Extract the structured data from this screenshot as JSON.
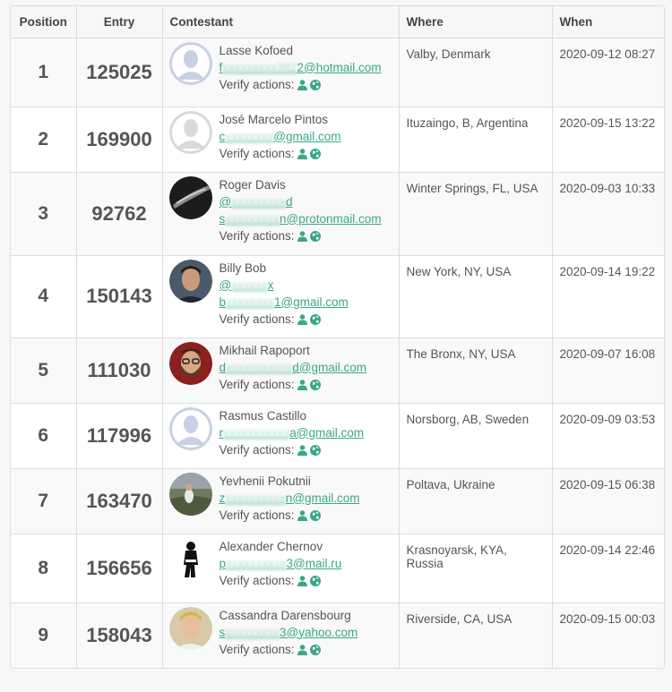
{
  "headers": {
    "position": "Position",
    "entry": "Entry",
    "contestant": "Contestant",
    "where": "Where",
    "when": "When"
  },
  "verify_label": "Verify actions:",
  "colors": {
    "accent": "#3aa68a",
    "header_bg": "#f7f7f7",
    "border": "#dddddd"
  },
  "rows": [
    {
      "position": "1",
      "entry": "125025",
      "name": "Lasse Kofoed",
      "where": "Valby, Denmark",
      "when": "2020-09-12 08:27",
      "avatar": "default-avatar-blue",
      "links": [
        {
          "pre": "f",
          "blur": "xxxxxxxxx382",
          "post": "2@hotmail.com"
        }
      ]
    },
    {
      "position": "2",
      "entry": "169900",
      "name": "José Marcelo Pintos",
      "where": "Ituzaingo, B, Argentina",
      "when": "2020-09-15 13:22",
      "avatar": "default-avatar-gray",
      "links": [
        {
          "pre": "c",
          "blur": "xxxxxxxx",
          "post": "@gmail.com"
        }
      ]
    },
    {
      "position": "3",
      "entry": "92762",
      "name": "Roger Davis",
      "where": "Winter Springs, FL, USA",
      "when": "2020-09-03 10:33",
      "avatar": "dark-photo-avatar",
      "links": [
        {
          "pre": "@",
          "blur": "xxxxxxxxx",
          "post": "d"
        },
        {
          "pre": "s",
          "blur": "xxxxxxxxx",
          "post": "n@protonmail.com"
        }
      ]
    },
    {
      "position": "4",
      "entry": "150143",
      "name": "Billy Bob",
      "where": "New York, NY, USA",
      "when": "2020-09-14 19:22",
      "avatar": "man-photo-avatar",
      "links": [
        {
          "pre": "@",
          "blur": "xxxxxx",
          "post": "x"
        },
        {
          "pre": "b",
          "blur": "xxxxxxxx",
          "post": "1@gmail.com"
        }
      ]
    },
    {
      "position": "5",
      "entry": "111030",
      "name": "Mikhail Rapoport",
      "where": "The Bronx, NY, USA",
      "when": "2020-09-07 16:08",
      "avatar": "bearded-man-avatar",
      "links": [
        {
          "pre": "d",
          "blur": "xxxxxxxxxxx",
          "post": "d@gmail.com"
        }
      ]
    },
    {
      "position": "6",
      "entry": "117996",
      "name": "Rasmus Castillo",
      "where": "Norsborg, AB, Sweden",
      "when": "2020-09-09 03:53",
      "avatar": "default-avatar-blue",
      "links": [
        {
          "pre": "r",
          "blur": "xxxxxxxxxxx",
          "post": "a@gmail.com"
        }
      ]
    },
    {
      "position": "7",
      "entry": "163470",
      "name": "Yevhenii Pokutnii",
      "where": "Poltava, Ukraine",
      "when": "2020-09-15 06:38",
      "avatar": "outdoor-photo-avatar",
      "links": [
        {
          "pre": "z",
          "blur": "xxxxxxxxxx",
          "post": "n@gmail.com"
        }
      ]
    },
    {
      "position": "8",
      "entry": "156656",
      "name": "Alexander Chernov",
      "where": "Krasnoyarsk, KYA, Russia",
      "when": "2020-09-14 22:46",
      "avatar": "silhouette-avatar",
      "links": [
        {
          "pre": "p",
          "blur": "xxxxxxxxxx",
          "post": "3@mail.ru"
        }
      ]
    },
    {
      "position": "9",
      "entry": "158043",
      "name": "Cassandra Darensbourg",
      "where": "Riverside, CA, USA",
      "when": "2020-09-15 00:03",
      "avatar": "blond-man-avatar",
      "links": [
        {
          "pre": "s",
          "blur": "xxxxxxxxx",
          "post": "3@yahoo.com"
        }
      ]
    }
  ]
}
